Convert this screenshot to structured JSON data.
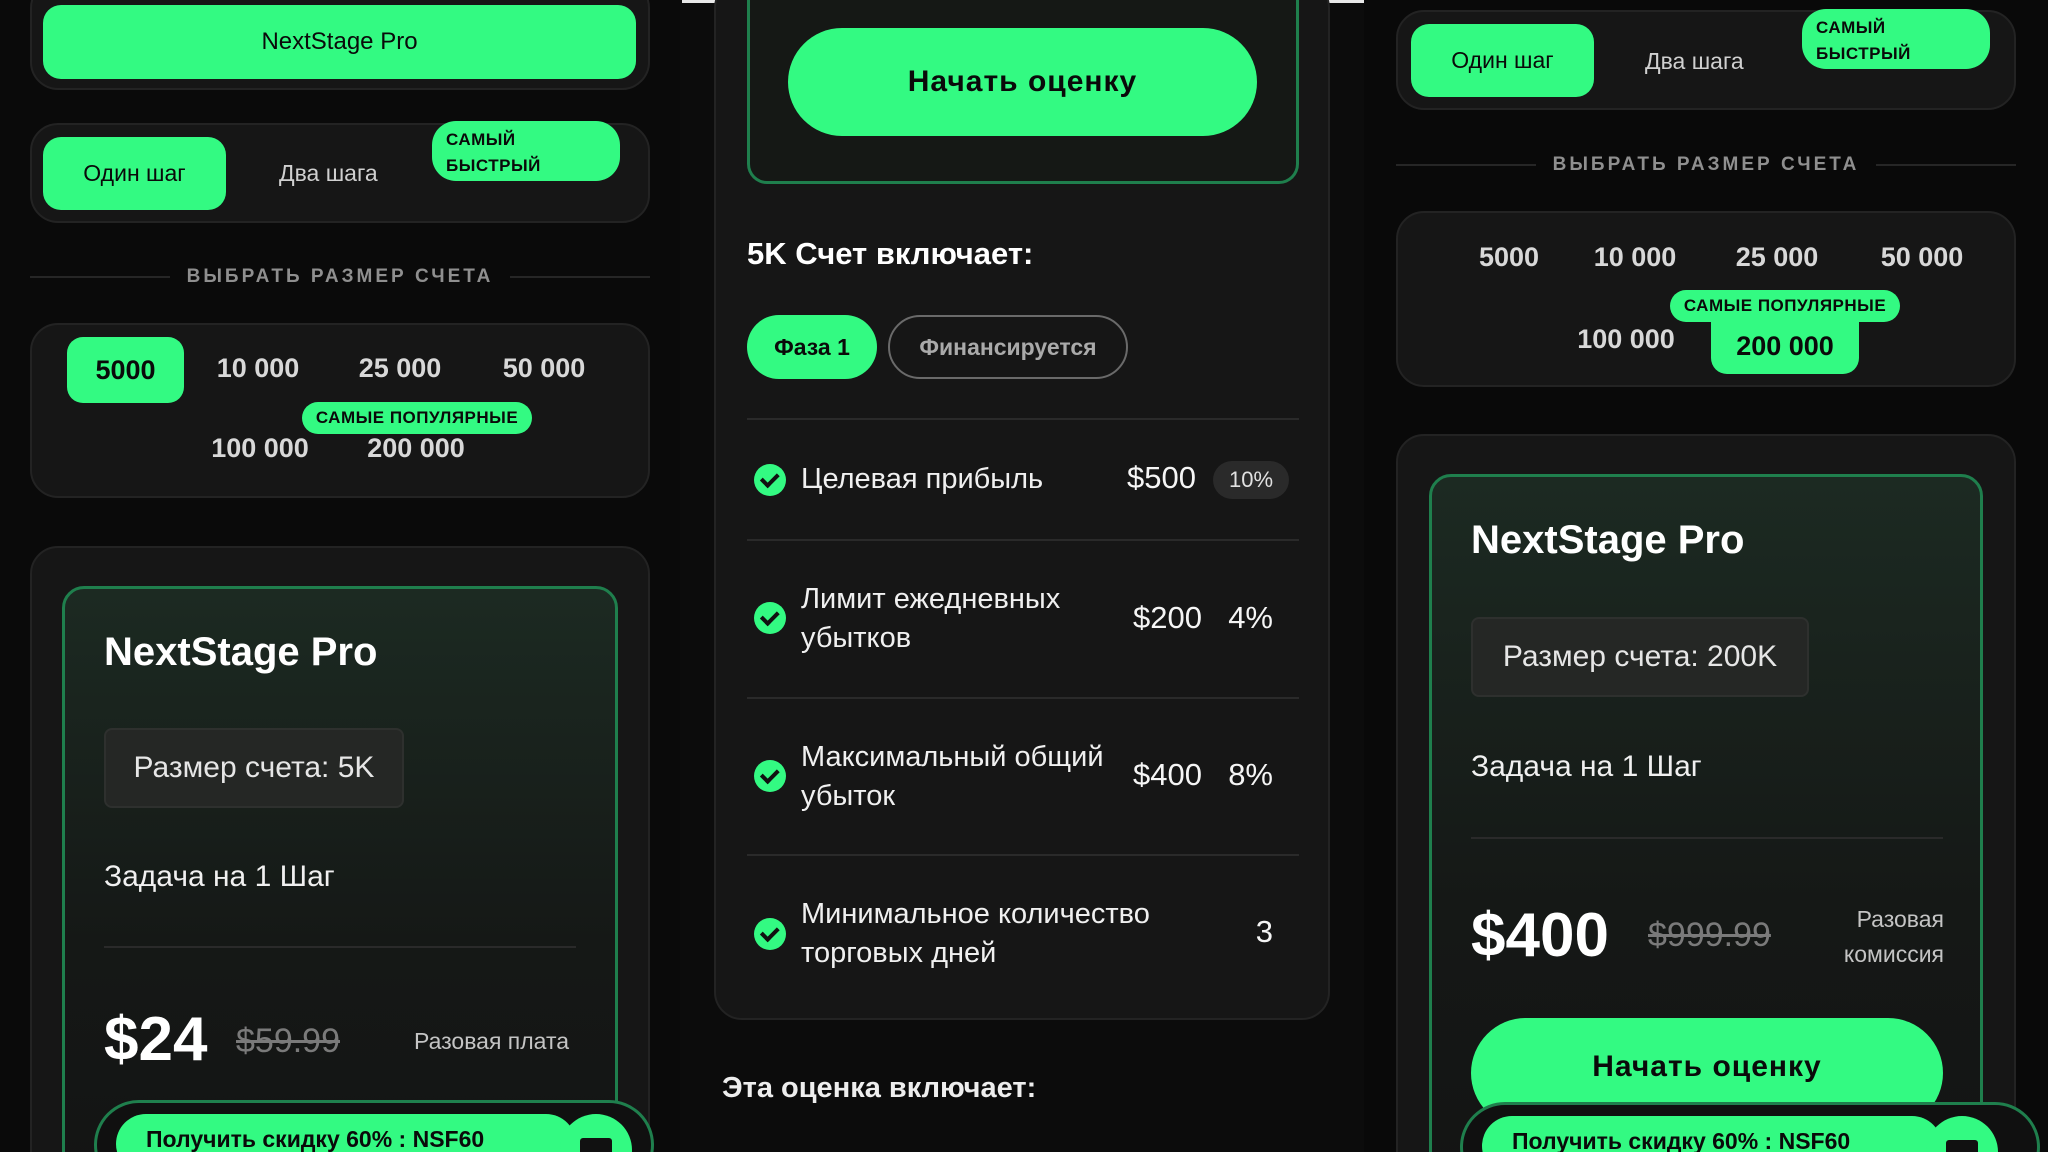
{
  "left": {
    "top_button": "NextStage Pro",
    "steps": {
      "one": "Один шаг",
      "two": "Два шага",
      "fastest_badge_line1": "САМЫЙ",
      "fastest_badge_line2": "БЫСТРЫЙ"
    },
    "choose_size_label": "ВЫБРАТЬ РАЗМЕР СЧЕТА",
    "sizes": [
      "5000",
      "10 000",
      "25 000",
      "50 000",
      "100 000",
      "200 000"
    ],
    "selected_size": "5000",
    "popular_badge": "САМЫЕ ПОПУЛЯРНЫЕ",
    "plan": {
      "title": "NextStage Pro",
      "account_size": "Размер счета: 5K",
      "task": "Задача на 1 Шаг",
      "price": "$24",
      "old_price": "$59.99",
      "fee_label": "Разовая плата"
    },
    "discount": "Получить скидку 60% : NSF60"
  },
  "middle": {
    "start_button": "Начать оценку",
    "includes_title": "5K Счет включает:",
    "tabs": {
      "phase": "Фаза 1",
      "funded": "Финансируется"
    },
    "rules": [
      {
        "label_line1": "Целевая прибыль",
        "label_line2": "",
        "value": "$500",
        "percent": "10%"
      },
      {
        "label_line1": "Лимит ежедневных",
        "label_line2": "убытков",
        "value": "$200",
        "percent": "4%"
      },
      {
        "label_line1": "Максимальный общий",
        "label_line2": "убыток",
        "value": "$400",
        "percent": "8%"
      },
      {
        "label_line1": "Минимальное количество",
        "label_line2": "торговых дней",
        "value": "3",
        "percent": ""
      }
    ],
    "assessment_includes": "Эта оценка включает:"
  },
  "right": {
    "steps": {
      "one": "Один шаг",
      "two": "Два шага",
      "fastest_badge_line1": "САМЫЙ",
      "fastest_badge_line2": "БЫСТРЫЙ"
    },
    "choose_size_label": "ВЫБРАТЬ РАЗМЕР СЧЕТА",
    "sizes": [
      "5000",
      "10 000",
      "25 000",
      "50 000",
      "100 000",
      "200 000"
    ],
    "selected_size": "200 000",
    "popular_badge": "САМЫЕ ПОПУЛЯРНЫЕ",
    "plan": {
      "title": "NextStage Pro",
      "account_size": "Размер счета: 200K",
      "task": "Задача на 1 Шаг",
      "price": "$400",
      "old_price": "$999.99",
      "fee_label_line1": "Разовая",
      "fee_label_line2": "комиссия"
    },
    "start_button": "Начать оценку",
    "discount": "Получить скидку 60% : NSF60"
  },
  "colors": {
    "accent": "#33fa82",
    "background": "#0a0a0a",
    "card": "#161616",
    "plan_border": "#1f7f4d"
  }
}
